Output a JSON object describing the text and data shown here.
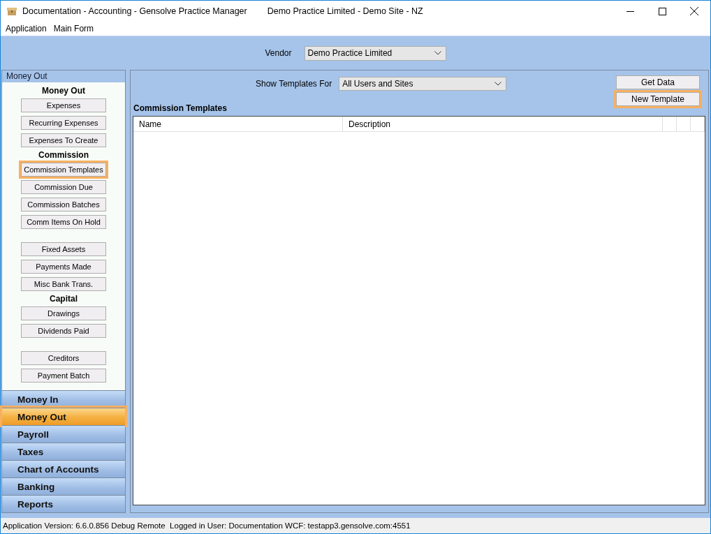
{
  "window": {
    "title": "Documentation - Accounting - Gensolve Practice Manager",
    "subtitle": "Demo Practice Limited - Demo Site - NZ"
  },
  "menu": [
    "Application",
    "Main Form"
  ],
  "vendor": {
    "label": "Vendor",
    "value": "Demo Practice Limited"
  },
  "sidebar": {
    "header": "Money Out",
    "items": [
      {
        "kind": "heading",
        "label": "Money Out"
      },
      {
        "kind": "button",
        "label": "Expenses",
        "highlighted": false
      },
      {
        "kind": "button",
        "label": "Recurring Expenses",
        "highlighted": false
      },
      {
        "kind": "button",
        "label": "Expenses To Create",
        "highlighted": false
      },
      {
        "kind": "heading",
        "label": "Commission"
      },
      {
        "kind": "button",
        "label": "Commission Templates",
        "highlighted": true
      },
      {
        "kind": "button",
        "label": "Commission Due",
        "highlighted": false
      },
      {
        "kind": "button",
        "label": "Commission Batches",
        "highlighted": false
      },
      {
        "kind": "button",
        "label": "Comm Items On Hold",
        "highlighted": false
      },
      {
        "kind": "gap"
      },
      {
        "kind": "button",
        "label": "Fixed Assets",
        "highlighted": false
      },
      {
        "kind": "button",
        "label": "Payments Made",
        "highlighted": false
      },
      {
        "kind": "button",
        "label": "Misc Bank Trans.",
        "highlighted": false
      },
      {
        "kind": "heading",
        "label": "Capital"
      },
      {
        "kind": "button",
        "label": "Drawings",
        "highlighted": false
      },
      {
        "kind": "button",
        "label": "Dividends Paid",
        "highlighted": false
      },
      {
        "kind": "gap"
      },
      {
        "kind": "button",
        "label": "Creditors",
        "highlighted": false
      },
      {
        "kind": "button",
        "label": "Payment Batch",
        "highlighted": false
      }
    ]
  },
  "sections": [
    {
      "label": "Money In",
      "selected": false
    },
    {
      "label": "Money Out",
      "selected": true
    },
    {
      "label": "Payroll",
      "selected": false
    },
    {
      "label": "Taxes",
      "selected": false
    },
    {
      "label": "Chart of Accounts",
      "selected": false
    },
    {
      "label": "Banking",
      "selected": false
    },
    {
      "label": "Reports",
      "selected": false
    }
  ],
  "filter": {
    "label": "Show Templates For",
    "value": "All Users and Sites"
  },
  "buttons": [
    {
      "label": "Get Data",
      "highlighted": false
    },
    {
      "label": "New Template",
      "highlighted": true
    }
  ],
  "table": {
    "title": "Commission Templates",
    "columns": [
      "Name",
      "Description"
    ]
  },
  "status_bar": "Application Version: 6.6.0.856 Debug Remote  Logged in User: Documentation WCF: testapp3.gensolve.com:4551"
}
